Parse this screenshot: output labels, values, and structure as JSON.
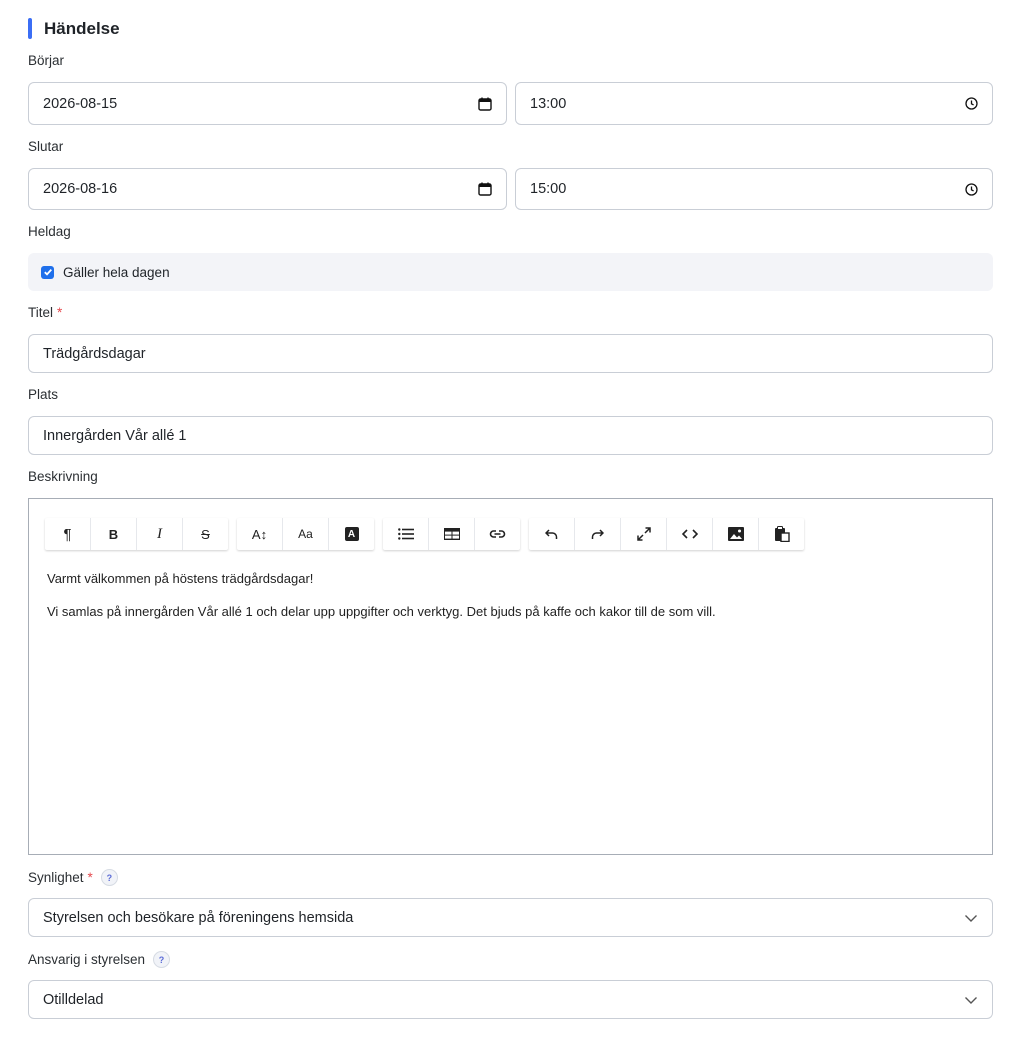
{
  "section": {
    "title": "Händelse"
  },
  "start": {
    "label": "Börjar",
    "date": "2026-08-15",
    "time": "13:00"
  },
  "end": {
    "label": "Slutar",
    "date": "2026-08-16",
    "time": "15:00"
  },
  "allday": {
    "label": "Heldag",
    "checkbox_label": "Gäller hela dagen",
    "checked": true
  },
  "title_field": {
    "label": "Titel",
    "required_mark": "*",
    "value": "Trädgårdsdagar"
  },
  "place": {
    "label": "Plats",
    "value": "Innergården Vår allé 1"
  },
  "description": {
    "label": "Beskrivning",
    "paragraphs": [
      "Varmt välkommen på höstens trädgårdsdagar!",
      "Vi samlas på innergården Vår allé 1 och delar upp uppgifter och verktyg. Det bjuds på kaffe och kakor till de som vill."
    ],
    "toolbar": {
      "paragraph": "¶",
      "bold": "B",
      "italic": "I",
      "strike": "S",
      "font_size": "A↕",
      "font_case": "Aa",
      "font_color": "A"
    }
  },
  "visibility": {
    "label": "Synlighet",
    "required_mark": "*",
    "help": "?",
    "value": "Styrelsen och besökare på föreningens hemsida"
  },
  "responsible": {
    "label": "Ansvarig i styrelsen",
    "help": "?",
    "value": "Otilldelad"
  },
  "colors": {
    "accent": "#3b6ef5",
    "required": "#e5484d",
    "checkbox": "#1f6feb"
  }
}
